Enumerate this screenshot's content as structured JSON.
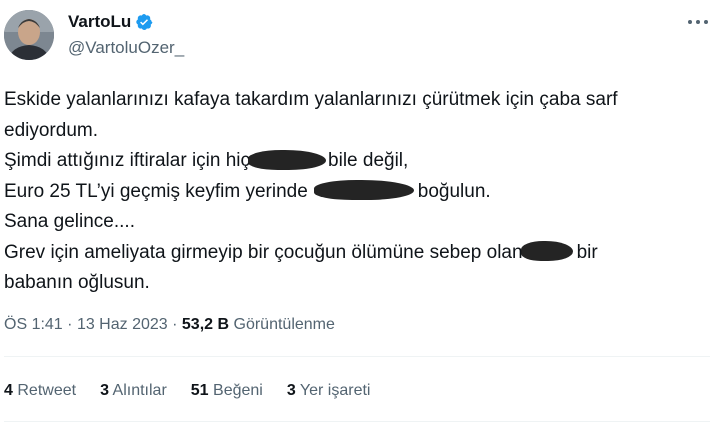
{
  "user": {
    "display_name": "VartoLu",
    "handle": "@VartoluOzer_"
  },
  "tweet": {
    "line1": "Eskide yalanlarınızı kafaya takardım yalanlarınızı çürütmek için çaba sarf",
    "line2": "ediyordum.",
    "line3_pre": "Şimdi attığınız iftiralar için hiç",
    "line3_post": "bile değil,",
    "line4_pre": "Euro 25 TL’yi geçmiş keyfim yerinde",
    "line4_post": "boğulun.",
    "line5": "Sana gelince....",
    "line6_pre": "Grev için ameliyata girmeyip bir çocuğun ölümüne sebep olan",
    "line6_post": "bir",
    "line7": "babanın oğlusun."
  },
  "meta": {
    "time": "ÖS 1:41",
    "separator": "·",
    "date": "13 Haz 2023",
    "views_count": "53,2 B",
    "views_label": "Görüntülenme"
  },
  "stats": {
    "retweets": {
      "count": "4",
      "label": "Retweet"
    },
    "quotes": {
      "count": "3",
      "label": "Alıntılar"
    },
    "likes": {
      "count": "51",
      "label": "Beğeni"
    },
    "bookmarks": {
      "count": "3",
      "label": "Yer işareti"
    }
  },
  "colors": {
    "verified": "#1d9bf0",
    "secondary_text": "#536471",
    "primary_text": "#0f1419"
  },
  "icons": {
    "verified": "verified-badge-icon",
    "more": "more-horizontal-icon"
  }
}
